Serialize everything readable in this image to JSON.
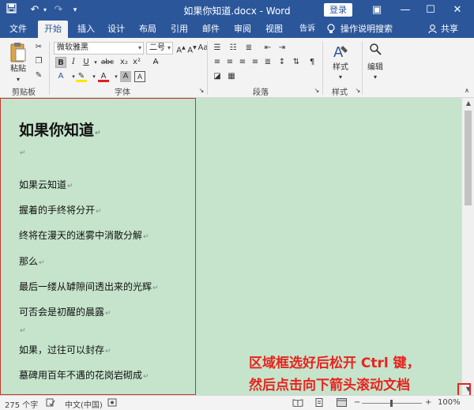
{
  "titlebar": {
    "doc_title": "如果你知道.docx - Word",
    "login_label": "登录",
    "save_icon": "save-icon",
    "undo_icon": "undo-icon",
    "redo_icon": "redo-icon"
  },
  "tabs": [
    {
      "label": "文件"
    },
    {
      "label": "开始",
      "active": true
    },
    {
      "label": "插入"
    },
    {
      "label": "设计"
    },
    {
      "label": "布局"
    },
    {
      "label": "引用"
    },
    {
      "label": "邮件"
    },
    {
      "label": "审阅"
    },
    {
      "label": "视图"
    },
    {
      "label": "告诉我…"
    },
    {
      "label": "操作说明搜索"
    },
    {
      "label": "共享"
    }
  ],
  "ribbon": {
    "paste_label": "粘贴",
    "clipboard_group": "剪贴板",
    "font_group": "字体",
    "paragraph_group": "段落",
    "styles_group": "样式",
    "styles_label": "样式",
    "editing_label": "编辑",
    "font_name": "微软雅黑",
    "font_size": "二号",
    "format_buttons": [
      "B",
      "I",
      "U",
      "abc",
      "x₂",
      "x²"
    ]
  },
  "document": {
    "heading": "如果你知道",
    "lines": [
      "",
      "如果云知道",
      "握着的手终将分开",
      "终将在漫天的迷雾中消散分解",
      "那么",
      "最后一缕从罅隙间透出来的光辉",
      "可否会是初醒的晨露",
      "",
      "如果，过往可以封存",
      "墓碑用百年不遇的花岗岩砌成"
    ],
    "paragraph_mark": "↵"
  },
  "annotation": {
    "line1": "区域框选好后松开 Ctrl 键，",
    "line2": "然后点击向下箭头滚动文档"
  },
  "statusbar": {
    "word_count": "275 个字",
    "language": "中文(中国)",
    "zoom": "100%"
  },
  "colors": {
    "word_blue": "#2b579a",
    "page_green": "#c5e4cb",
    "annotation_red": "#e8231e"
  }
}
